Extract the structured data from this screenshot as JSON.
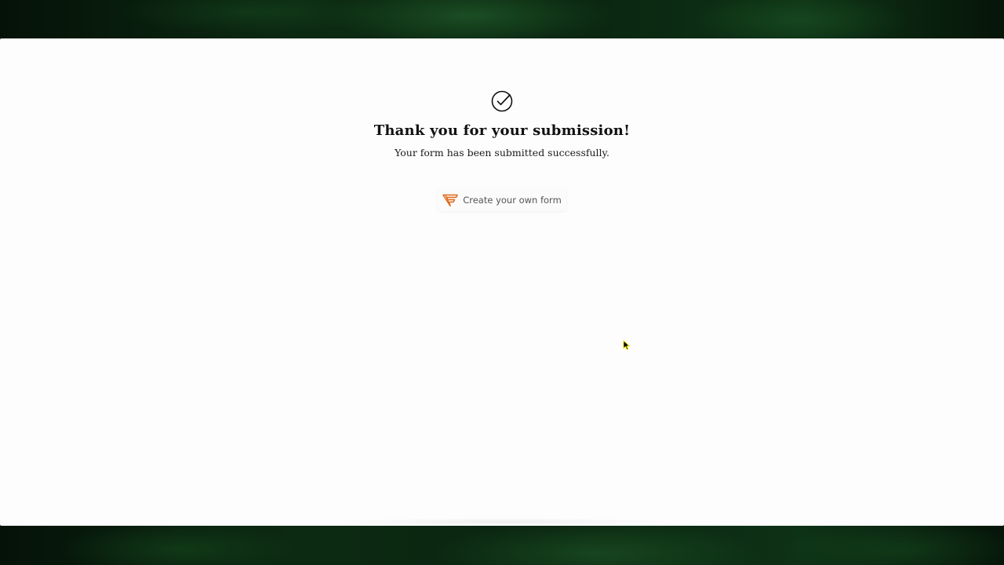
{
  "page": {
    "background_color": "#0b2a10",
    "card_color": "#fdfdfd"
  },
  "success": {
    "icon": "check-circle-icon",
    "title": "Thank you for your submission!",
    "message": "Your form has been submitted successfully."
  },
  "create_form_button": {
    "icon": "brand-logo-icon",
    "icon_color": "#e06a1b",
    "label": "Create your own form"
  },
  "cursor": {
    "icon": "mouse-pointer-icon"
  }
}
